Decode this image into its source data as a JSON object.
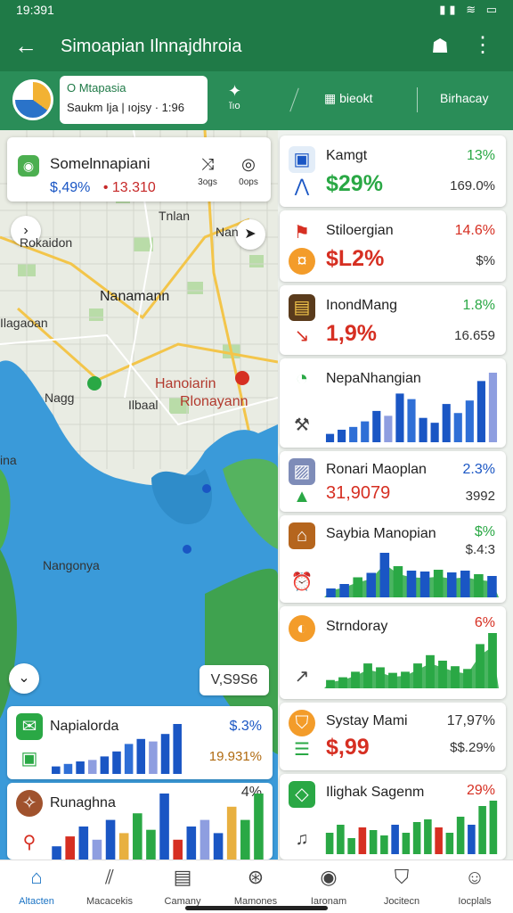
{
  "status": {
    "time": "19:391",
    "icons": "▮▮ ≋ ▭"
  },
  "app": {
    "title": "Simoapian Ilnnajdhroia",
    "back_icon": "arrow-left-icon",
    "account_icon": "account-icon",
    "more_icon": "more-vert-icon"
  },
  "subbar": {
    "location_title": "O Mtapasia",
    "location_sub": "Saukm Ija | ıojsy · 1:96",
    "items": [
      "ĭıo",
      "bieokt",
      "Birhacay"
    ]
  },
  "map": {
    "card": {
      "name": "Somelnnapiani",
      "value1": "$,49%",
      "value2": "• 13.310",
      "tool1": "3ogs",
      "tool2": "0ops"
    },
    "labels": [
      "Tnlan",
      "Nan",
      "Rokaidon",
      "Nanamann",
      "Ilagaoan",
      "Nagg",
      "Ilbaal",
      "Hanoiarin",
      "Rlonayann",
      "ina",
      "Nangonya"
    ],
    "scale": "V,S9S6"
  },
  "cards": [
    {
      "name": "Kamgt",
      "pct": "13%",
      "value": "$29%",
      "sub": "169.0%"
    },
    {
      "name": "Stiloergian",
      "pct": "14.6%",
      "value": "$L2%",
      "sub": "$%"
    },
    {
      "name": "InondMang",
      "pct": "1.8%",
      "value": "1,9%",
      "sub": "16.659"
    },
    {
      "name": "NepaNhangian",
      "bars": [
        12,
        18,
        22,
        30,
        45,
        38,
        70,
        62,
        35,
        28,
        55,
        42,
        60,
        88,
        100
      ]
    },
    {
      "name": "Ronari Maoplan",
      "pct": "2.3%",
      "value": "31,9079",
      "sub": "3992"
    },
    {
      "name": "Saybia Manopian",
      "pct": "$%",
      "sub": "$.4:3",
      "bars": [
        20,
        30,
        45,
        55,
        100,
        70,
        60,
        58,
        62,
        56,
        60,
        52,
        48
      ]
    },
    {
      "name": "Strndoray",
      "pct": "6%",
      "bars": [
        15,
        20,
        30,
        45,
        38,
        28,
        30,
        45,
        60,
        50,
        40,
        35,
        80,
        100
      ]
    },
    {
      "name": "Systay Mami",
      "pct": "17,97%",
      "value": "$,99",
      "sub": "$$.29%"
    },
    {
      "name": "Ilighak Sagenm",
      "pct": "29%",
      "bars": [
        40,
        55,
        30,
        50,
        45,
        35,
        55,
        40,
        60,
        65,
        50,
        40,
        70,
        55,
        90,
        100
      ]
    }
  ],
  "bottom_cards": [
    {
      "name": "Napialorda",
      "pct": "$.3%",
      "sub": "19.931%",
      "bars": [
        15,
        20,
        25,
        28,
        35,
        45,
        60,
        70,
        65,
        80,
        100
      ]
    },
    {
      "name": "Runaghna",
      "pct": "4%",
      "bars": [
        20,
        35,
        50,
        30,
        60,
        40,
        70,
        45,
        100,
        30,
        50,
        60,
        40,
        80,
        60,
        100
      ]
    }
  ],
  "nav": [
    "Altacten",
    "Macacekis",
    "Camany",
    "Mamones",
    "Iaronam",
    "Jocitecn",
    "Iocplals"
  ],
  "colors": {
    "primary": "#1f7a47",
    "accent": "#2aa845",
    "blue": "#1a56c4",
    "red": "#d62f22"
  }
}
